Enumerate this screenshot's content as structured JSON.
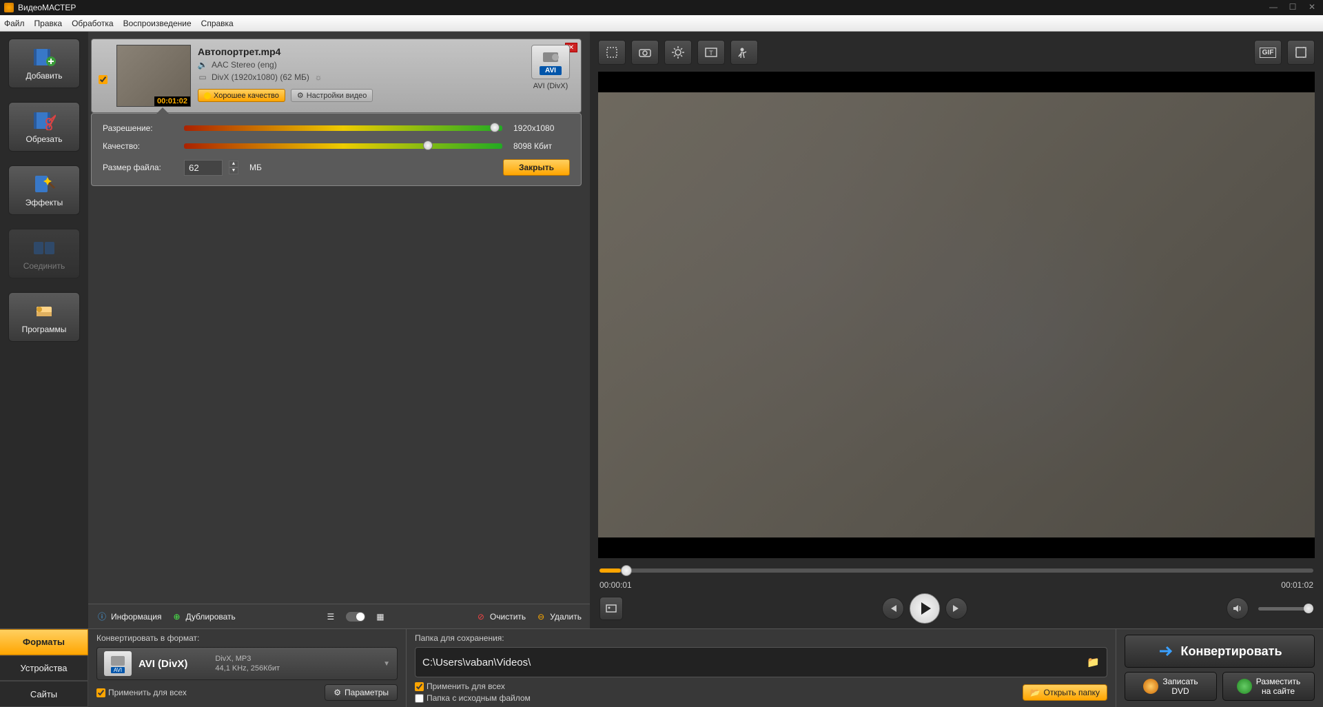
{
  "app": {
    "title": "ВидеоМАСТЕР"
  },
  "menu": [
    "Файл",
    "Правка",
    "Обработка",
    "Воспроизведение",
    "Справка"
  ],
  "sidebar": [
    {
      "label": "Добавить",
      "icon": "add"
    },
    {
      "label": "Обрезать",
      "icon": "cut"
    },
    {
      "label": "Эффекты",
      "icon": "fx"
    },
    {
      "label": "Соединить",
      "icon": "join",
      "disabled": true
    },
    {
      "label": "Программы",
      "icon": "apps"
    }
  ],
  "file": {
    "title": "Автопортрет.mp4",
    "audio": "AAC Stereo (eng)",
    "video": "DivX (1920x1080) (62 МБ)",
    "duration": "00:01:02",
    "quality_pill": "Хорошее качество",
    "settings_pill": "Настройки видео",
    "format": {
      "badge": "AVI",
      "label": "AVI (DivX)"
    }
  },
  "quality": {
    "resolution_label": "Разрешение:",
    "resolution_value": "1920x1080",
    "quality_label": "Качество:",
    "quality_value": "8098 Кбит",
    "size_label": "Размер файла:",
    "size_value": "62",
    "size_unit": "МБ",
    "close": "Закрыть"
  },
  "list_toolbar": {
    "info": "Информация",
    "duplicate": "Дублировать",
    "clear": "Очистить",
    "delete": "Удалить"
  },
  "preview": {
    "time_current": "00:00:01",
    "time_total": "00:01:02"
  },
  "bottom": {
    "tabs": [
      "Форматы",
      "Устройства",
      "Сайты"
    ],
    "convert_label": "Конвертировать в формат:",
    "format": {
      "title": "AVI (DivX)",
      "sub1": "DivX, MP3",
      "sub2": "44,1 KHz, 256Кбит",
      "badge": "AVI"
    },
    "apply_all": "Применить для всех",
    "params": "Параметры",
    "save_label": "Папка для сохранения:",
    "path": "C:\\Users\\vaban\\Videos\\",
    "open_folder": "Открыть папку",
    "folder_source": "Папка с исходным файлом",
    "convert_btn": "Конвертировать",
    "burn_dvd": "Записать DVD",
    "upload_site": "Разместить на сайте"
  }
}
